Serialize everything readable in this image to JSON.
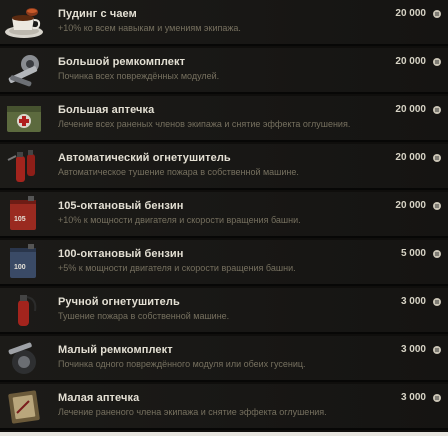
{
  "currency_icon": "credits-icon",
  "items": [
    {
      "title": "Пудинг с чаем",
      "desc": "+10% ко всем навыкам и умениям экипажа.",
      "price": "20 000",
      "icon": "pudding-tea-icon"
    },
    {
      "title": "Большой ремкомплект",
      "desc": "Починка всех повреждённых модулей.",
      "price": "20 000",
      "icon": "large-repair-kit-icon"
    },
    {
      "title": "Большая аптечка",
      "desc": "Лечение всех раненых членов экипажа и снятие эффекта оглушения.",
      "price": "20 000",
      "icon": "large-first-aid-kit-icon"
    },
    {
      "title": "Автоматический огнетушитель",
      "desc": "Автоматическое тушение пожара в собственной машине.",
      "price": "20 000",
      "icon": "automatic-fire-extinguisher-icon"
    },
    {
      "title": "105-октановый бензин",
      "desc": "+10% к мощности двигателя и скорости вращения башни.",
      "price": "20 000",
      "icon": "fuel-105-icon"
    },
    {
      "title": "100-октановый бензин",
      "desc": "+5% к мощности двигателя и скорости вращения башни.",
      "price": "5 000",
      "icon": "fuel-100-icon"
    },
    {
      "title": "Ручной огнетушитель",
      "desc": "Тушение пожара в собственной машине.",
      "price": "3 000",
      "icon": "manual-fire-extinguisher-icon"
    },
    {
      "title": "Малый ремкомплект",
      "desc": "Починка одного повреждённого модуля или обеих гусениц.",
      "price": "3 000",
      "icon": "small-repair-kit-icon"
    },
    {
      "title": "Малая аптечка",
      "desc": "Лечение раненого члена экипажа и снятие эффекта оглушения.",
      "price": "3 000",
      "icon": "small-first-aid-kit-icon"
    }
  ],
  "badges": {
    "fuel_105": "105",
    "fuel_100": "100"
  }
}
